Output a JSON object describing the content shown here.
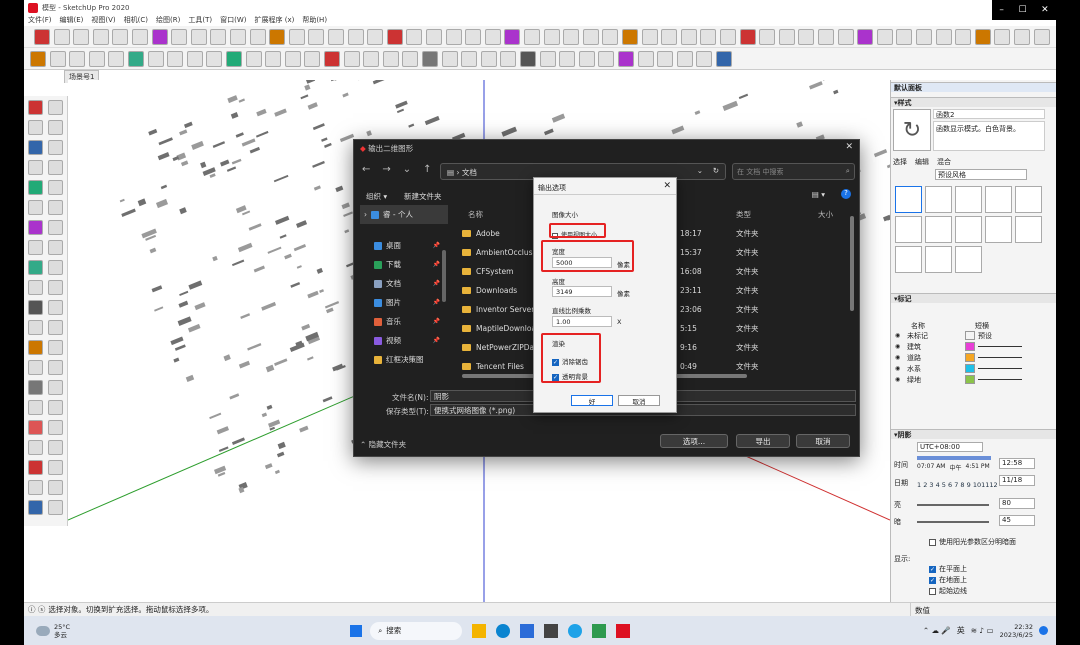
{
  "window": {
    "title": "模型 - SketchUp Pro 2020",
    "min_label": "–",
    "max_label": "☐",
    "close_label": "✕"
  },
  "menu": [
    "文件(F)",
    "编辑(E)",
    "视图(V)",
    "相机(C)",
    "绘图(R)",
    "工具(T)",
    "窗口(W)",
    "扩展程序 (x)",
    "帮助(H)"
  ],
  "scene_tab": "场景号1",
  "status": {
    "hint": "选择对象。切换到扩充选择。拖动鼠标选择多项。",
    "measure_label": "数值"
  },
  "export_dialog": {
    "title": "输出二维图形",
    "path": "文档",
    "search_placeholder": "在 文档 中搜索",
    "organize": "组织 ▾",
    "new_folder": "新建文件夹",
    "sidebar": [
      {
        "label": "睿 - 个人",
        "icon": "cloud-icon",
        "color": "#3b8de0"
      },
      {
        "label": "桌面",
        "icon": "desktop-icon",
        "color": "#3b8de0"
      },
      {
        "label": "下载",
        "icon": "download-icon",
        "color": "#2aa05a"
      },
      {
        "label": "文档",
        "icon": "document-icon",
        "color": "#8aa0c0"
      },
      {
        "label": "图片",
        "icon": "pictures-icon",
        "color": "#3b8de0"
      },
      {
        "label": "音乐",
        "icon": "music-icon",
        "color": "#e0603b"
      },
      {
        "label": "视频",
        "icon": "video-icon",
        "color": "#8a5be0"
      },
      {
        "label": "红框决策图",
        "icon": "folder-icon",
        "color": "#e8b33a"
      }
    ],
    "columns": {
      "name": "名称",
      "type": "类型",
      "size": "大小"
    },
    "files": [
      {
        "name": "Adobe",
        "time": "18:17",
        "type": "文件夹"
      },
      {
        "name": "AmbientOcclusion",
        "time": "15:37",
        "type": "文件夹"
      },
      {
        "name": "CFSystem",
        "time": "16:08",
        "type": "文件夹"
      },
      {
        "name": "Downloads",
        "time": "23:11",
        "type": "文件夹"
      },
      {
        "name": "Inventor Server fo",
        "time": "23:06",
        "type": "文件夹"
      },
      {
        "name": "MaptileDownload",
        "time": "5:15",
        "type": "文件夹"
      },
      {
        "name": "NetPowerZIPData",
        "time": "9:16",
        "type": "文件夹"
      },
      {
        "name": "Tencent Files",
        "time": "0:49",
        "type": "文件夹"
      }
    ],
    "filename_label": "文件名(N):",
    "filename_value": "阴影",
    "filetype_label": "保存类型(T):",
    "filetype_value": "便携式网络图像 (*.png)",
    "hide_folders": "隐藏文件夹",
    "options_btn": "选项...",
    "export_btn": "导出",
    "cancel_btn": "取消"
  },
  "options_dialog": {
    "title": "输出选项",
    "size_section": "图像大小",
    "use_view_size": "使用视图大小",
    "width_label": "宽度",
    "width_value": "5000",
    "width_unit": "像素",
    "height_label": "高度",
    "height_value": "3149",
    "height_unit": "像素",
    "ratio_label": "直线比例乘数",
    "ratio_value": "1.00",
    "ratio_unit": "X",
    "render_section": "渲染",
    "antialias": "消除锯齿",
    "transparent_bg": "透明背景",
    "ok": "好",
    "cancel": "取消"
  },
  "right_panel": {
    "tray_title": "默认面板",
    "styles": {
      "header": "样式",
      "name": "函数2",
      "desc": "函数显示模式。白色背景。",
      "tabs": [
        "选择",
        "编辑",
        "混合"
      ],
      "dropdown": "预设风格"
    },
    "tags": {
      "header": "标记",
      "col_name": "名称",
      "col_dash": "短横",
      "items": [
        {
          "name": "未标记",
          "dash": "预设",
          "color": "#f4f4f4"
        },
        {
          "name": "建筑",
          "dash": "",
          "color": "#e83fd6"
        },
        {
          "name": "道路",
          "dash": "",
          "color": "#f5a623"
        },
        {
          "name": "水系",
          "dash": "",
          "color": "#1ec0e8"
        },
        {
          "name": "绿地",
          "dash": "",
          "color": "#8bc34a"
        }
      ]
    },
    "shadows": {
      "header": "阴影",
      "tz": "UTC+08:00",
      "time_label": "时间",
      "time_start": "07:07 AM",
      "time_mid": "中午",
      "time_end": "4:51 PM",
      "time_value": "12:58",
      "date_label": "日期",
      "date_months": "1 2 3 4 5 6 7 8 9 101112",
      "date_value": "11/18",
      "light_label": "亮",
      "light_value": "80",
      "dark_label": "暗",
      "dark_value": "45",
      "sun_option": "使用阳光参数区分明暗面",
      "display_label": "显示:",
      "on_faces": "在平面上",
      "on_ground": "在地面上",
      "from_edges": "起始边线"
    }
  },
  "taskbar": {
    "temp": "25°C",
    "weather": "多云",
    "search": "搜索",
    "ime": "英",
    "time": "22:32",
    "date": "2023/6/25"
  }
}
